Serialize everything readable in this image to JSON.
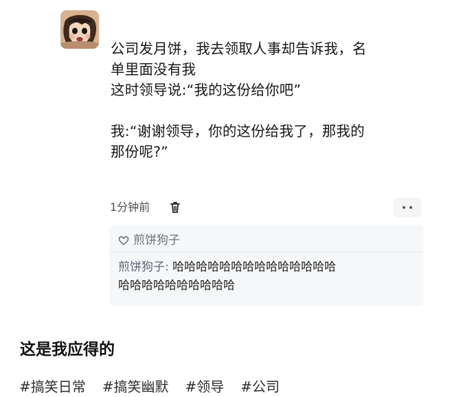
{
  "post": {
    "lines": [
      "公司发月饼，我去领取人事却告诉我，名",
      "单里面没有我",
      "这时领导说:“我的这份给你吧”",
      "我:“谢谢领导，你的这份给我了，那我的",
      "那份呢?”"
    ],
    "time": "1分钟前"
  },
  "reply": {
    "liker": "煎饼狗子",
    "author": "煎饼狗子:",
    "text_line_1": "哈哈哈哈哈哈哈哈哈哈哈哈哈哈",
    "text_line_2": "哈哈哈哈哈哈哈哈哈哈"
  },
  "caption": "这是我应得的",
  "tags": [
    "#搞笑日常",
    "#搞笑幽默",
    "#领导",
    "#公司"
  ],
  "icons": {
    "avatar": "avatar-child-photo",
    "delete": "trash-icon",
    "more": "more-dots-icon",
    "like": "heart-outline-icon"
  },
  "colors": {
    "background": "#ffffff",
    "reply_background": "#f6f7f8",
    "author_text": "#5f6775"
  }
}
